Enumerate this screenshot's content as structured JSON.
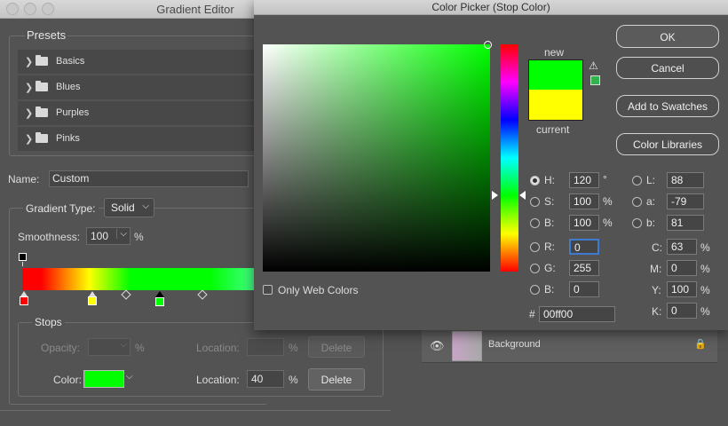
{
  "gradient_editor": {
    "title": "Gradient Editor",
    "presets_label": "Presets",
    "presets": [
      {
        "label": "Basics"
      },
      {
        "label": "Blues"
      },
      {
        "label": "Purples"
      },
      {
        "label": "Pinks"
      }
    ],
    "name_label": "Name:",
    "name_value": "Custom",
    "gradient_type_label": "Gradient Type:",
    "gradient_type_value": "Solid",
    "smoothness_label": "Smoothness:",
    "smoothness_value": "100",
    "smoothness_unit": "%",
    "stops": {
      "label": "Stops",
      "opacity_label": "Opacity:",
      "opacity_unit": "%",
      "opacity_location_label": "Location:",
      "opacity_location_unit": "%",
      "opacity_delete_label": "Delete",
      "color_label": "Color:",
      "color_swatch": "#00ff00",
      "color_location_label": "Location:",
      "color_location_value": "40",
      "color_location_unit": "%",
      "color_delete_label": "Delete"
    },
    "stop_colors": [
      "#ff0000",
      "#ffff00",
      "#00ff00"
    ]
  },
  "layers": {
    "background_label": "Background"
  },
  "color_picker": {
    "title": "Color Picker (Stop Color)",
    "new_label": "new",
    "current_label": "current",
    "new_color": "#00ff00",
    "current_color": "#ffff00",
    "buttons": {
      "ok": "OK",
      "cancel": "Cancel",
      "add_to_swatches": "Add to Swatches",
      "color_libraries": "Color Libraries"
    },
    "hsb": {
      "h_label": "H:",
      "h_value": "120",
      "h_unit": "°",
      "s_label": "S:",
      "s_value": "100",
      "s_unit": "%",
      "b_label": "B:",
      "b_value": "100",
      "b_unit": "%"
    },
    "rgb": {
      "r_label": "R:",
      "r_value": "0",
      "g_label": "G:",
      "g_value": "255",
      "b_label": "B:",
      "b_value": "0"
    },
    "lab": {
      "l_label": "L:",
      "l_value": "88",
      "a_label": "a:",
      "a_value": "-79",
      "b_label": "b:",
      "b_value": "81"
    },
    "cmyk": {
      "c_label": "C:",
      "c_value": "63",
      "c_unit": "%",
      "m_label": "M:",
      "m_value": "0",
      "m_unit": "%",
      "y_label": "Y:",
      "y_value": "100",
      "y_unit": "%",
      "k_label": "K:",
      "k_value": "0",
      "k_unit": "%"
    },
    "hex_label": "#",
    "hex_value": "00ff00",
    "only_web_colors_label": "Only Web Colors"
  }
}
